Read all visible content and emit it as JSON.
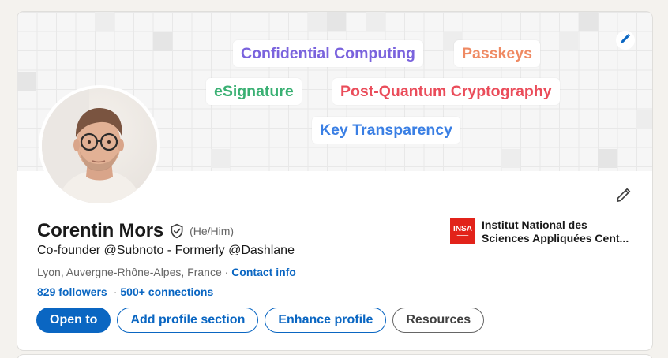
{
  "banner": {
    "tags": [
      {
        "label": "Confidential Computing",
        "color": "#7a63dd"
      },
      {
        "label": "Passkeys",
        "color": "#ef8a63"
      },
      {
        "label": "eSignature",
        "color": "#3ab073"
      },
      {
        "label": "Post-Quantum Cryptography",
        "color": "#ea4c5a"
      },
      {
        "label": "Key Transparency",
        "color": "#3a7fe4"
      }
    ],
    "edit_icon": "pencil-icon"
  },
  "profile": {
    "name": "Corentin Mors",
    "verified_icon": "verified-shield-icon",
    "pronouns": "(He/Him)",
    "headline": "Co-founder @Subnoto - Formerly @Dashlane",
    "location": "Lyon, Auvergne-Rhône-Alpes, France",
    "location_separator": " · ",
    "contact_info": "Contact info",
    "followers": "829 followers",
    "stats_separator": "·",
    "connections": "500+ connections",
    "edit_icon": "pencil-icon"
  },
  "education": {
    "logo_text": "INSA",
    "line1": "Institut National des",
    "line2": "Sciences Appliquées Cent..."
  },
  "actions": {
    "open_to": "Open to",
    "add_section": "Add profile section",
    "enhance": "Enhance profile",
    "resources": "Resources"
  },
  "colors": {
    "primary": "#0a66c2",
    "background": "#f4f2ee"
  }
}
